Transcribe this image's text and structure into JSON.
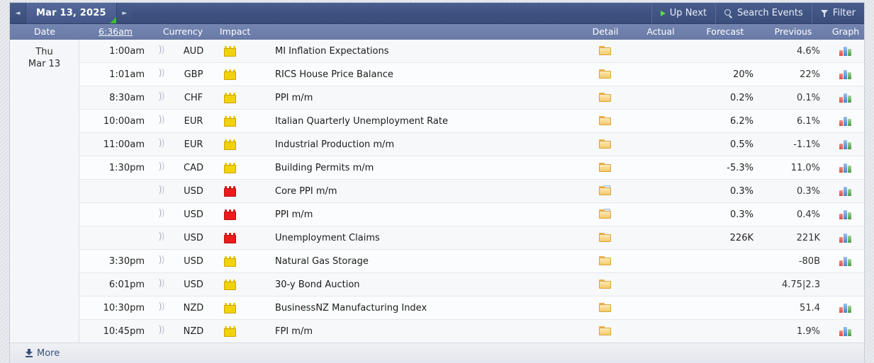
{
  "toolbar": {
    "prev_arrow": "◄",
    "next_arrow": "►",
    "date_label": "Mar 13, 2025",
    "up_next_label": "Up Next",
    "search_label": "Search Events",
    "filter_label": "Filter"
  },
  "columns": {
    "date": "Date",
    "time": "6:36am",
    "currency": "Currency",
    "impact": "Impact",
    "event": "",
    "detail": "Detail",
    "actual": "Actual",
    "forecast": "Forecast",
    "previous": "Previous",
    "graph": "Graph"
  },
  "day": {
    "dow": "Thu",
    "dom": "Mar 13"
  },
  "colors": {
    "header_blue": "#3d5180",
    "subheader_blue": "#6a7ba8",
    "impact_yellow": "#f2d20c",
    "impact_red": "#eb1c1c",
    "accent_green": "#3fbb33",
    "link_blue": "#3a4f7c"
  },
  "rows": [
    {
      "time": "1:00am",
      "currency": "AUD",
      "impact": "yellow",
      "event": "MI Inflation Expectations",
      "detail": "folder",
      "actual": "",
      "forecast": "",
      "previous": "4.6%",
      "graph": true
    },
    {
      "time": "1:01am",
      "currency": "GBP",
      "impact": "yellow",
      "event": "RICS House Price Balance",
      "detail": "folder",
      "actual": "",
      "forecast": "20%",
      "previous": "22%",
      "graph": true
    },
    {
      "time": "8:30am",
      "currency": "CHF",
      "impact": "yellow",
      "event": "PPI m/m",
      "detail": "folder",
      "actual": "",
      "forecast": "0.2%",
      "previous": "0.1%",
      "graph": true
    },
    {
      "time": "10:00am",
      "currency": "EUR",
      "impact": "yellow",
      "event": "Italian Quarterly Unemployment Rate",
      "detail": "folder",
      "actual": "",
      "forecast": "6.2%",
      "previous": "6.1%",
      "graph": true
    },
    {
      "time": "11:00am",
      "currency": "EUR",
      "impact": "yellow",
      "event": "Industrial Production m/m",
      "detail": "folder",
      "actual": "",
      "forecast": "0.5%",
      "previous": "-1.1%",
      "graph": true
    },
    {
      "time": "1:30pm",
      "currency": "CAD",
      "impact": "yellow",
      "event": "Building Permits m/m",
      "detail": "folder",
      "actual": "",
      "forecast": "-5.3%",
      "previous": "11.0%",
      "graph": true
    },
    {
      "time": "",
      "currency": "USD",
      "impact": "red",
      "event": "Core PPI m/m",
      "detail": "folder-page",
      "actual": "",
      "forecast": "0.3%",
      "previous": "0.3%",
      "graph": true
    },
    {
      "time": "",
      "currency": "USD",
      "impact": "red",
      "event": "PPI m/m",
      "detail": "folder-page",
      "actual": "",
      "forecast": "0.3%",
      "previous": "0.4%",
      "graph": true
    },
    {
      "time": "",
      "currency": "USD",
      "impact": "red",
      "event": "Unemployment Claims",
      "detail": "folder",
      "actual": "",
      "forecast": "226K",
      "previous": "221K",
      "graph": true
    },
    {
      "time": "3:30pm",
      "currency": "USD",
      "impact": "yellow",
      "event": "Natural Gas Storage",
      "detail": "folder",
      "actual": "",
      "forecast": "",
      "previous": "-80B",
      "graph": true
    },
    {
      "time": "6:01pm",
      "currency": "USD",
      "impact": "yellow",
      "event": "30-y Bond Auction",
      "detail": "folder",
      "actual": "",
      "forecast": "",
      "previous": "4.75|2.3",
      "graph": false
    },
    {
      "time": "10:30pm",
      "currency": "NZD",
      "impact": "yellow",
      "event": "BusinessNZ Manufacturing Index",
      "detail": "folder",
      "actual": "",
      "forecast": "",
      "previous": "51.4",
      "graph": true
    },
    {
      "time": "10:45pm",
      "currency": "NZD",
      "impact": "yellow",
      "event": "FPI m/m",
      "detail": "folder",
      "actual": "",
      "forecast": "",
      "previous": "1.9%",
      "graph": true
    }
  ],
  "footer": {
    "more_label": "More"
  }
}
